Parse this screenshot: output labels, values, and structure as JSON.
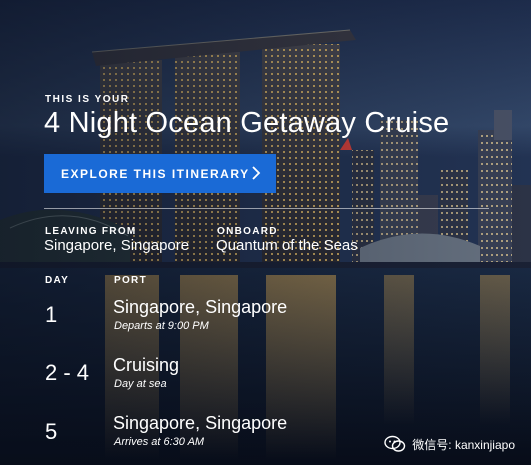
{
  "hero": {
    "eyebrow": "THIS IS YOUR",
    "title": "4 Night Ocean Getaway Cruise",
    "cta_label": "EXPLORE THIS ITINERARY"
  },
  "trip": {
    "leaving_label": "LEAVING FROM",
    "leaving_value": "Singapore, Singapore",
    "onboard_label": "ONBOARD",
    "onboard_value": "Quantum of the Seas"
  },
  "itinerary": {
    "day_header": "DAY",
    "port_header": "PORT",
    "rows": [
      {
        "day": "1",
        "port": "Singapore, Singapore",
        "note": "Departs at 9:00 PM"
      },
      {
        "day": "2 - 4",
        "port": "Cruising",
        "note": "Day at sea"
      },
      {
        "day": "5",
        "port": "Singapore, Singapore",
        "note": "Arrives at 6:30 AM"
      }
    ]
  },
  "watermark": {
    "text": "微信号: kanxinjiapo",
    "logo_icon": "wechat-logo-icon"
  },
  "colors": {
    "cta_blue": "#1a6ad6",
    "text": "#ffffff",
    "night_sky": "#1a2a4a"
  }
}
